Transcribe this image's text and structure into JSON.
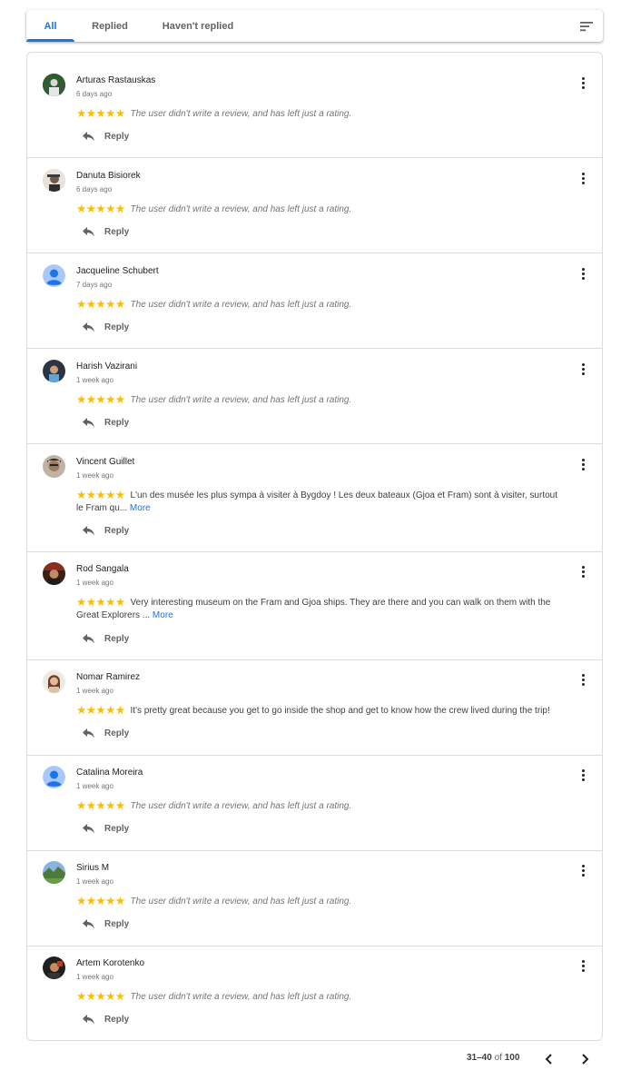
{
  "tabs": {
    "all": "All",
    "replied": "Replied",
    "not_replied": "Haven't replied"
  },
  "colors": {
    "accent": "#1a73e8",
    "star": "#fbbc04"
  },
  "stars_glyph": "★★★★★",
  "reviews": [
    {
      "name": "Arturas Rastauskas",
      "time": "6 days ago",
      "rating": 5,
      "text": "The user didn't write a review, and has left just a rating.",
      "placeholder": true,
      "reply": "Reply"
    },
    {
      "name": "Danuta Bisiorek",
      "time": "6 days ago",
      "rating": 5,
      "text": "The user didn't write a review, and has left just a rating.",
      "placeholder": true,
      "reply": "Reply"
    },
    {
      "name": "Jacqueline Schubert",
      "time": "7 days ago",
      "rating": 5,
      "text": "The user didn't write a review, and has left just a rating.",
      "placeholder": true,
      "reply": "Reply"
    },
    {
      "name": "Harish Vazirani",
      "time": "1 week ago",
      "rating": 5,
      "text": "The user didn't write a review, and has left just a rating.",
      "placeholder": true,
      "reply": "Reply"
    },
    {
      "name": "Vincent Guillet",
      "time": "1 week ago",
      "rating": 5,
      "text": "L'un des musée les plus sympa à visiter à Bygdoy ! Les deux bateaux (Gjoa et Fram) sont à visiter, surtout le Fram qu...",
      "more": "More",
      "placeholder": false,
      "reply": "Reply"
    },
    {
      "name": "Rod Sangala",
      "time": "1 week ago",
      "rating": 5,
      "text": "Very interesting museum on the Fram and Gjoa ships. They are there and you can walk on them with the Great Explorers ...",
      "more": "More",
      "placeholder": false,
      "reply": "Reply"
    },
    {
      "name": "Nomar Ramirez",
      "time": "1 week ago",
      "rating": 5,
      "text": "It's pretty great because you get to go inside the shop and get to know how the crew lived during the trip!",
      "placeholder": false,
      "reply": "Reply"
    },
    {
      "name": "Catalina Moreira",
      "time": "1 week ago",
      "rating": 5,
      "text": "The user didn't write a review, and has left just a rating.",
      "placeholder": true,
      "reply": "Reply"
    },
    {
      "name": "Sirius M",
      "time": "1 week ago",
      "rating": 5,
      "text": "The user didn't write a review, and has left just a rating.",
      "placeholder": true,
      "reply": "Reply"
    },
    {
      "name": "Artem Korotenko",
      "time": "1 week ago",
      "rating": 5,
      "text": "The user didn't write a review, and has left just a rating.",
      "placeholder": true,
      "reply": "Reply"
    }
  ],
  "pagination": {
    "range": "31–40",
    "of": "of",
    "total": "100"
  }
}
